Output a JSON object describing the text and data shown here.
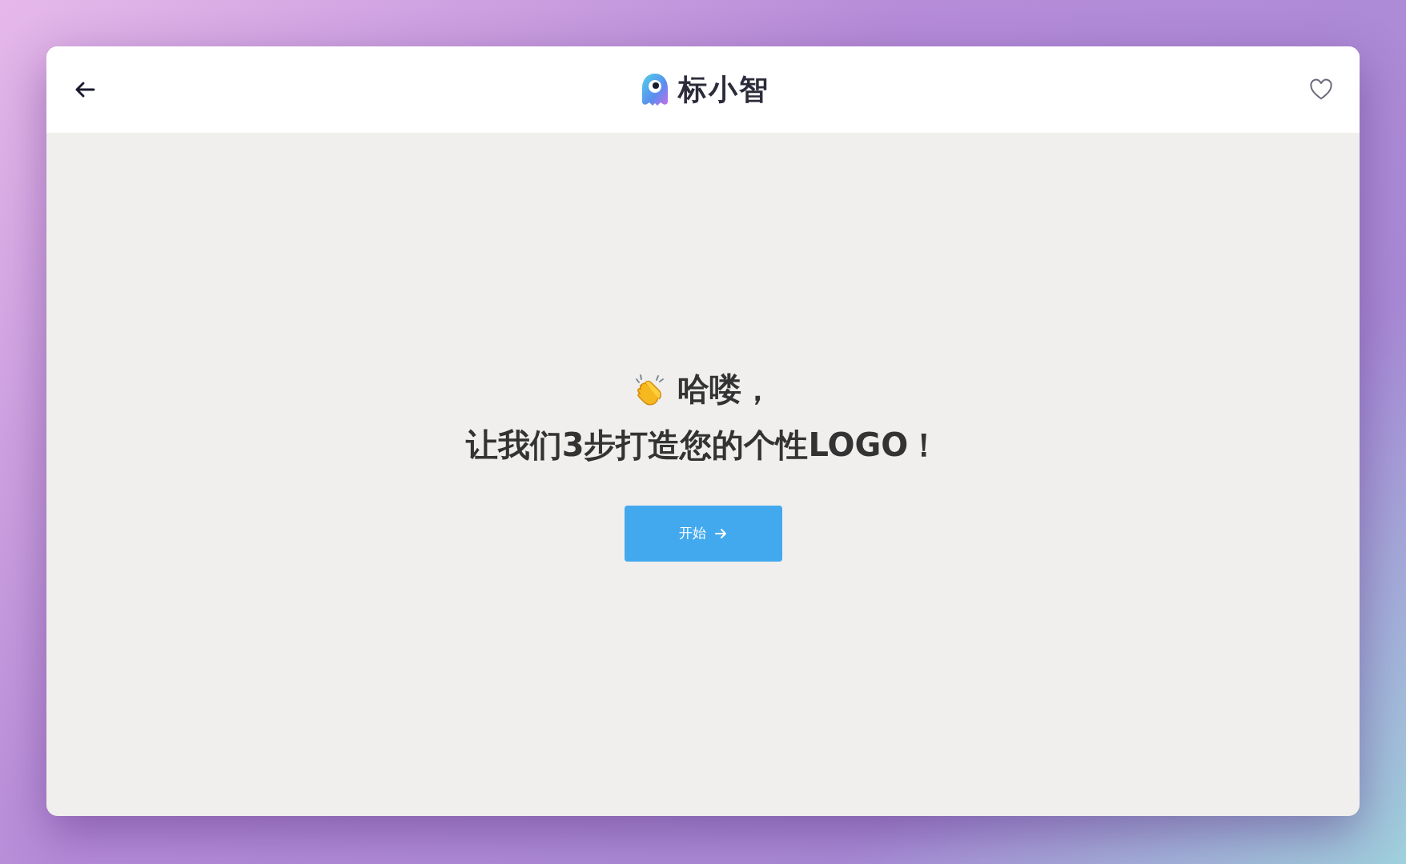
{
  "header": {
    "brand": "标小智"
  },
  "hero": {
    "greeting": "哈喽，",
    "headline": "让我们3步打造您的个性LOGO！"
  },
  "start_button": {
    "label": "开始"
  }
}
